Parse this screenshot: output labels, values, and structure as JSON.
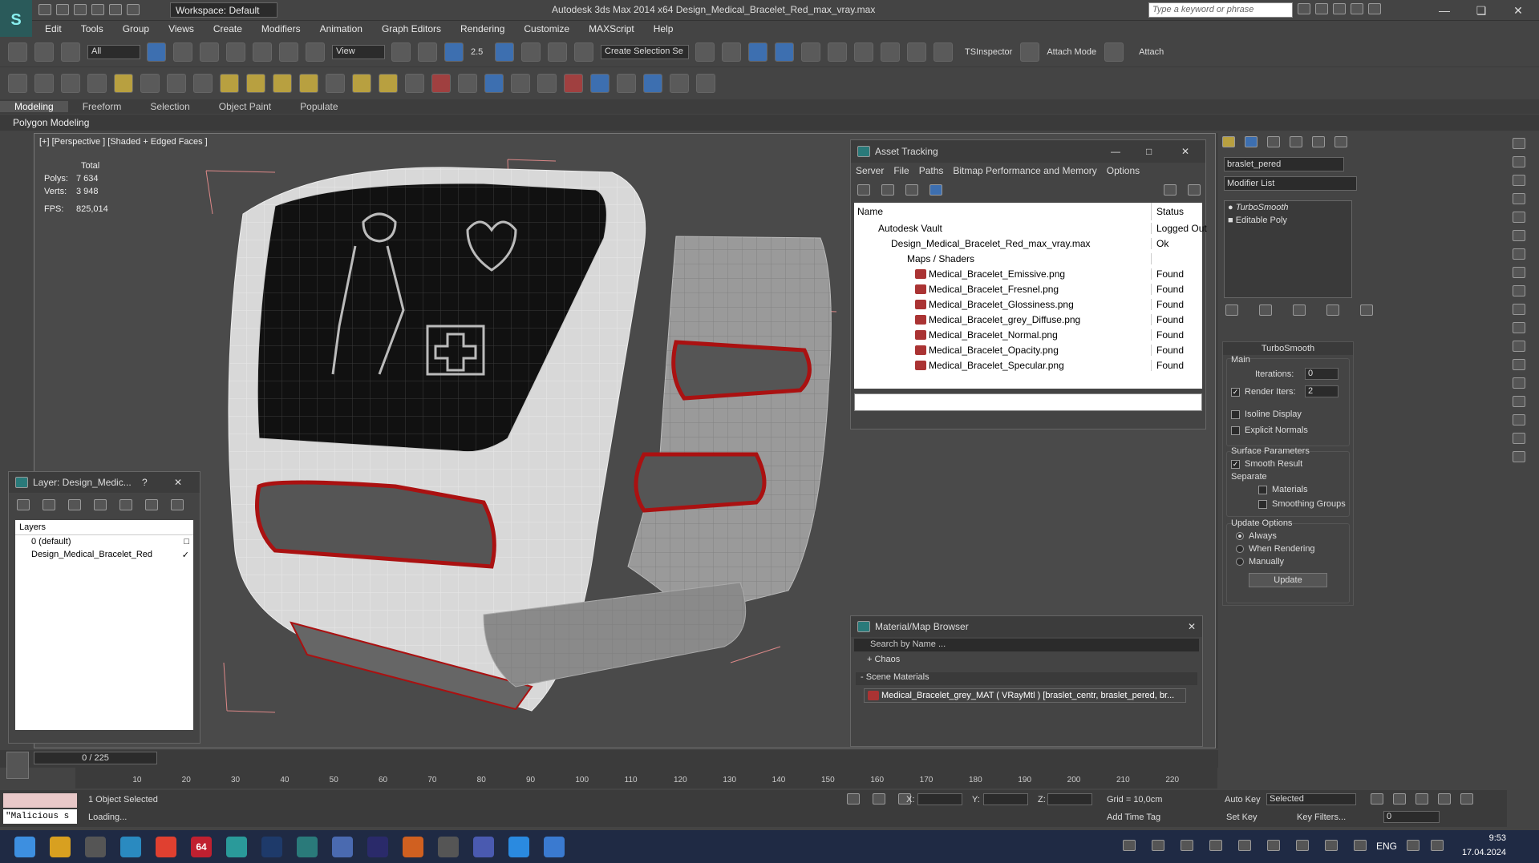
{
  "app": {
    "title": "Autodesk 3ds Max  2014 x64     Design_Medical_Bracelet_Red_max_vray.max",
    "workspace": "Workspace: Default",
    "search_placeholder": "Type a keyword or phrase"
  },
  "menu": [
    "Edit",
    "Tools",
    "Group",
    "Views",
    "Create",
    "Modifiers",
    "Animation",
    "Graph Editors",
    "Rendering",
    "Customize",
    "MAXScript",
    "Help"
  ],
  "toolbar": {
    "selection_filter": "All",
    "ref_coord": "View",
    "snap_value": "2.5",
    "named_selection": "Create Selection Se",
    "ts_inspector": "TSInspector",
    "attach_mode": "Attach Mode",
    "attach": "Attach"
  },
  "ribbon": {
    "tabs": [
      "Modeling",
      "Freeform",
      "Selection",
      "Object Paint",
      "Populate"
    ],
    "sub": "Polygon Modeling"
  },
  "viewport": {
    "label": "[+] [Perspective ] [Shaded + Edged Faces ]",
    "stats_header": "Total",
    "polys_label": "Polys:",
    "polys_value": "7 634",
    "verts_label": "Verts:",
    "verts_value": "3 948",
    "fps_label": "FPS:",
    "fps_value": "825,014"
  },
  "layer_panel": {
    "title": "Layer: Design_Medic...",
    "help": "?",
    "header": "Layers",
    "items": [
      "0 (default)",
      "Design_Medical_Bracelet_Red"
    ]
  },
  "asset_tracking": {
    "title": "Asset Tracking",
    "menu": [
      "Server",
      "File",
      "Paths",
      "Bitmap Performance and Memory",
      "Options"
    ],
    "col_name": "Name",
    "col_status": "Status",
    "rows": [
      {
        "name": "Autodesk Vault",
        "status": "Logged Out"
      },
      {
        "name": "Design_Medical_Bracelet_Red_max_vray.max",
        "status": "Ok"
      },
      {
        "name": "Maps / Shaders",
        "status": ""
      },
      {
        "name": "Medical_Bracelet_Emissive.png",
        "status": "Found"
      },
      {
        "name": "Medical_Bracelet_Fresnel.png",
        "status": "Found"
      },
      {
        "name": "Medical_Bracelet_Glossiness.png",
        "status": "Found"
      },
      {
        "name": "Medical_Bracelet_grey_Diffuse.png",
        "status": "Found"
      },
      {
        "name": "Medical_Bracelet_Normal.png",
        "status": "Found"
      },
      {
        "name": "Medical_Bracelet_Opacity.png",
        "status": "Found"
      },
      {
        "name": "Medical_Bracelet_Specular.png",
        "status": "Found"
      }
    ]
  },
  "material_browser": {
    "title": "Material/Map Browser",
    "search": "Search by Name ...",
    "chaos": "+ Chaos",
    "scene_materials": "- Scene Materials",
    "material": "Medical_Bracelet_grey_MAT ( VRayMtl ) [braslet_centr, braslet_pered, br..."
  },
  "command_panel": {
    "object_name": "braslet_pered",
    "modifier_list": "Modifier List",
    "stack": [
      "TurboSmooth",
      "Editable Poly"
    ],
    "rollout_title": "TurboSmooth",
    "main": "Main",
    "iterations_label": "Iterations:",
    "iterations_value": "0",
    "render_iters_label": "Render Iters:",
    "render_iters_value": "2",
    "isoline": "Isoline Display",
    "explicit_normals": "Explicit Normals",
    "surface_params": "Surface Parameters",
    "smooth_result": "Smooth Result",
    "separate": "Separate",
    "materials": "Materials",
    "smoothing_groups": "Smoothing Groups",
    "update_options": "Update Options",
    "always": "Always",
    "when_rendering": "When Rendering",
    "manually": "Manually",
    "update": "Update"
  },
  "timeline": {
    "frame": "0 / 225",
    "ticks": [
      "10",
      "20",
      "30",
      "40",
      "50",
      "60",
      "70",
      "80",
      "90",
      "100",
      "110",
      "120",
      "130",
      "140",
      "150",
      "160",
      "170",
      "180",
      "190",
      "200",
      "210",
      "220"
    ]
  },
  "status": {
    "selected": "1 Object Selected",
    "loading": "Loading...",
    "script": "\"Malicious s",
    "x_label": "X:",
    "y_label": "Y:",
    "z_label": "Z:",
    "grid": "Grid = 10,0cm",
    "add_time_tag": "Add Time Tag",
    "auto_key": "Auto Key",
    "set_key": "Set Key",
    "selected_dropdown": "Selected",
    "key_filters": "Key Filters...",
    "frame_field": "0"
  },
  "taskbar": {
    "lang": "ENG",
    "time": "9:53",
    "date": "17.04.2024",
    "badge": "64"
  }
}
